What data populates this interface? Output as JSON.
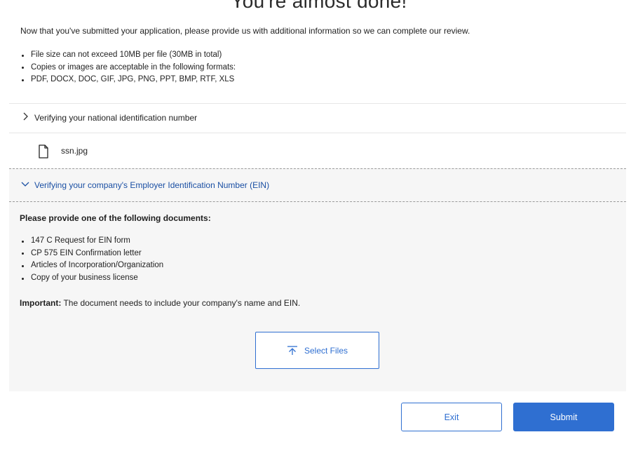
{
  "page": {
    "title": "You're almost done!",
    "intro": "Now that you've submitted your application, please provide us with additional information so we can complete our review."
  },
  "requirements": [
    "File size can not exceed 10MB per file (30MB in total)",
    "Copies or images are acceptable in the following formats:",
    "PDF, DOCX, DOC, GIF, JPG, PNG, PPT, BMP, RTF, XLS"
  ],
  "sections": {
    "ssn": {
      "label": "Verifying your national identification number",
      "expanded": false,
      "uploaded_file": "ssn.jpg"
    },
    "ein": {
      "label": "Verifying your company's Employer Identification Number (EIN)",
      "expanded": true,
      "heading": "Please provide one of the following documents:",
      "documents": [
        "147 C Request for EIN form",
        "CP 575 EIN Confirmation letter",
        "Articles of Incorporation/Organization",
        "Copy of your business license"
      ],
      "important_label": "Important:",
      "important_text": " The document needs to include your company's name and EIN.",
      "select_files_label": "Select Files"
    }
  },
  "footer": {
    "exit_label": "Exit",
    "submit_label": "Submit"
  },
  "colors": {
    "accent": "#2f6fd1",
    "link": "#1a4fa3",
    "panel_bg": "#f6f6f6"
  },
  "icons": {
    "collapsed_chevron": "chevron-right-icon",
    "expanded_chevron": "chevron-down-icon",
    "file": "file-icon",
    "upload": "upload-icon"
  }
}
